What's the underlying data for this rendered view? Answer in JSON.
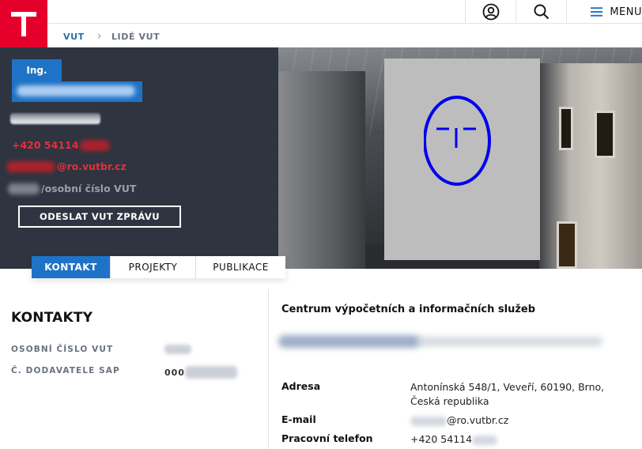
{
  "header": {
    "menu_label": "MENU",
    "icons": [
      "user-icon",
      "search-icon",
      "hamburger-icon"
    ]
  },
  "breadcrumb": {
    "home": "VUT",
    "current": "LIDÉ VUT"
  },
  "profile": {
    "title": "Ing.",
    "phone_visible": "+420 54114",
    "email_visible": "@ro.vutbr.cz",
    "personal_number_label": "/osobní číslo VUT",
    "send_message_button": "ODESLAT VUT ZPRÁVU"
  },
  "tabs": [
    {
      "label": "KONTAKT",
      "active": true
    },
    {
      "label": "PROJEKTY",
      "active": false
    },
    {
      "label": "PUBLIKACE",
      "active": false
    }
  ],
  "contacts": {
    "heading": "KONTAKTY",
    "fields": [
      {
        "label": "OSOBNÍ ČÍSLO VUT",
        "value": ""
      },
      {
        "label": "Č. DODAVATELE SAP",
        "value": "000"
      }
    ]
  },
  "department": {
    "name": "Centrum výpočetních a informačních služeb",
    "rows": [
      {
        "label": "Adresa",
        "value": "Antonínská 548/1, Veveří, 60190, Brno, Česká republika"
      },
      {
        "label": "E-mail",
        "value": "@ro.vutbr.cz"
      },
      {
        "label": "Pracovní telefon",
        "value": "+420 54114"
      }
    ]
  },
  "colors": {
    "brand_red": "#e4002b",
    "accent_blue": "#1f73c6",
    "hero_dark": "#2e3440",
    "contact_red": "#e4303a"
  }
}
